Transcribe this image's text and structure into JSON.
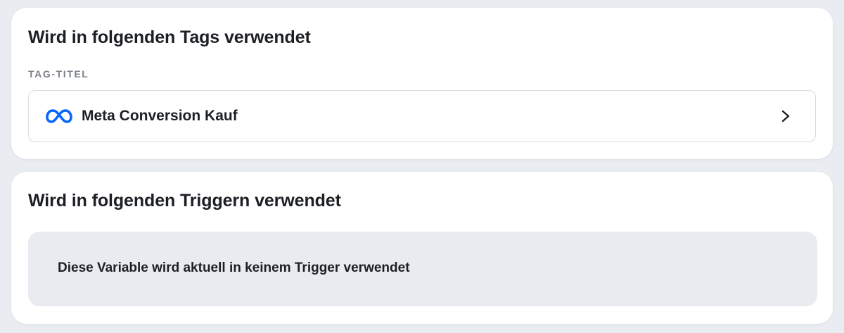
{
  "tags_card": {
    "title": "Wird in folgenden Tags verwendet",
    "column_label": "TAG-TITEL",
    "items": [
      {
        "label": "Meta Conversion Kauf",
        "icon": "meta-logo-icon",
        "icon_color": "#0866ff"
      }
    ]
  },
  "triggers_card": {
    "title": "Wird in folgenden Triggern verwendet",
    "empty_message": "Diese Variable wird aktuell in keinem Trigger verwendet"
  },
  "colors": {
    "page_background": "#e9ecf1",
    "card_background": "#ffffff",
    "empty_box_background": "#e8ebf0",
    "label_muted": "#7b8089"
  }
}
